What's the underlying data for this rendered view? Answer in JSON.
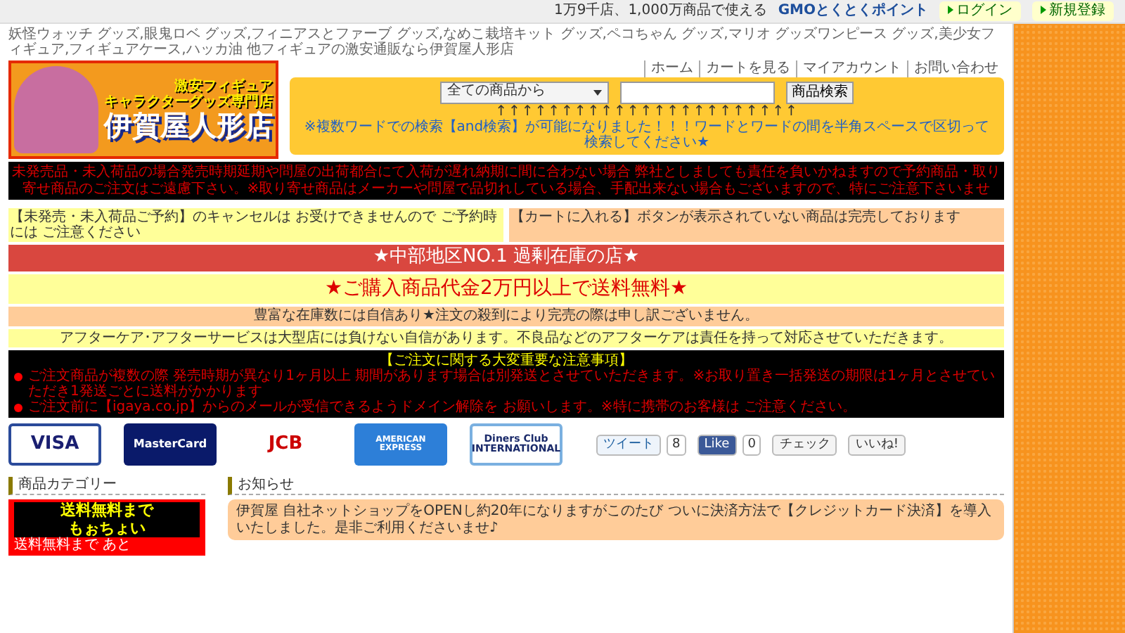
{
  "top_bar": {
    "promo": "1万9千店、1,000万商品で使える",
    "points_logo": "GMOとくとくポイント",
    "buttons": [
      {
        "label": "ログイン"
      },
      {
        "label": "新規登録"
      }
    ]
  },
  "keywords": "妖怪ウォッチ グッズ,眼鬼ロベ グッズ,フィニアスとファーブ グッズ,なめこ栽培キット グッズ,ペコちゃん グッズ,マリオ グッズワンピース グッズ,美少女フィギュア,フィギュアケース,ハッカ油 他フィギュアの激安通販なら伊賀屋人形店",
  "logo": {
    "lines": [
      "激安フィギュア",
      "キャラクターグッズ専門店",
      "伊賀屋人形店"
    ]
  },
  "nav": [
    "ホーム",
    "カートを見る",
    "マイアカウント",
    "お問い合わせ"
  ],
  "search": {
    "category": "全ての商品から",
    "button": "商品検索",
    "arrows": "↑↑↑↑↑↑↑↑↑↑↑↑↑↑↑↑↑↑↑↑↑↑↑",
    "hint": "※複数ワードでの検索【and検索】が可能になりました！！！ワードとワードの間を半角スペースで区切って検索してください★"
  },
  "notices": [
    {
      "kind": "black",
      "text": "未発売品・未入荷品の場合発売時期延期や問屋の出荷都合にて入荷が遅れ納期に間に合わない場合 弊社としましても責任を負いかねますので予約商品・取り寄せ商品のご注文はご遠慮下さい。※取り寄せ商品はメーカーや問屋で品切れしている場合、手配出来ない場合もございますので、特にご注意下さいませ"
    },
    {
      "kind": "pair",
      "left": "【未発売・未入荷品ご予約】のキャンセルは お受けできませんので ご予約時には ご注意ください",
      "right": "【カートに入れる】ボタンが表示されていない商品は完売しております"
    },
    {
      "kind": "banner_red",
      "text": "★中部地区NO.1 過剰在庫の店★"
    },
    {
      "kind": "banner_yellow",
      "text": "★ご購入商品代金2万円以上で送料無料★"
    },
    {
      "kind": "peach",
      "text": "豊富な在庫数には自信あり★注文の殺到により完売の際は申し訳ございません。"
    },
    {
      "kind": "yellow",
      "text": "アフターケア･アフターサービスは大型店には負けない自信があります。不良品などのアフターケアは責任を持って対応させていただきます。"
    },
    {
      "kind": "important",
      "title": "【ご注文に関する大変重要な注意事項】",
      "items": [
        "ご注文商品が複数の際 発売時期が異なり1ヶ月以上 期間があります場合は別発送とさせていただきます。※お取り置き一括発送の期限は1ヶ月とさせていただき1発送ごとに送料がかかります",
        "ご注文前に【igaya.co.jp】からのメールが受信できるようドメイン解除を お願いします。※特に携帯のお客様は ご注意ください。"
      ]
    }
  ],
  "cards": [
    {
      "kind": "visa",
      "label": "VISA"
    },
    {
      "kind": "mastercard",
      "label": "MasterCard"
    },
    {
      "kind": "jcb",
      "label": "JCB"
    },
    {
      "kind": "amex",
      "label": "AMERICAN EXPRESS"
    },
    {
      "kind": "diners",
      "label": "Diners Club INTERNATIONAL"
    }
  ],
  "social": [
    {
      "kind": "tweet",
      "label": "ツイート",
      "count": "8"
    },
    {
      "kind": "like",
      "label": "Like",
      "count": "0"
    },
    {
      "kind": "check",
      "label": "チェック"
    },
    {
      "kind": "iine",
      "label": "いいね!"
    }
  ],
  "category": {
    "heading": "商品カテゴリー",
    "banner_title": [
      "送料無料まで",
      "もぉちょい"
    ],
    "banner_text": "送料無料まで あと"
  },
  "news": {
    "heading": "お知らせ",
    "text": "伊賀屋 自社ネットショップをOPENし約20年になりますがこのたび ついに決済方法で【クレジットカード決済】を導入いたしました。是非ご利用くださいませ♪"
  }
}
